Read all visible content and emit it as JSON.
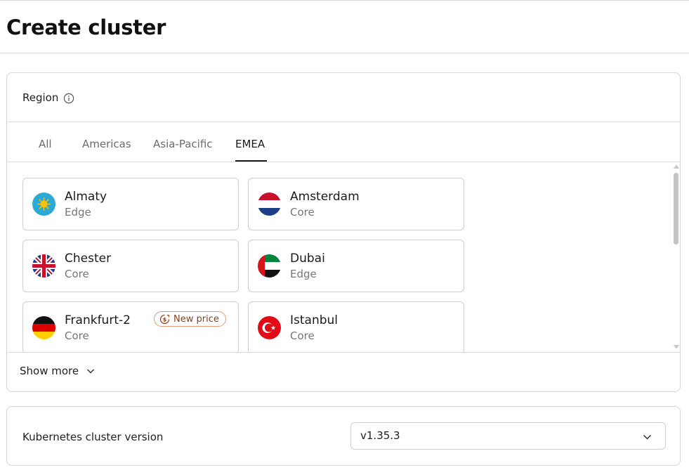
{
  "page": {
    "title": "Create cluster"
  },
  "region": {
    "label": "Region",
    "tabs": [
      {
        "label": "All",
        "active": false
      },
      {
        "label": "Americas",
        "active": false
      },
      {
        "label": "Asia-Pacific",
        "active": false
      },
      {
        "label": "EMEA",
        "active": true
      }
    ],
    "locations": [
      {
        "name": "Almaty",
        "type": "Edge",
        "flag": "kazakhstan-flag-icon"
      },
      {
        "name": "Amsterdam",
        "type": "Core",
        "flag": "netherlands-flag-icon"
      },
      {
        "name": "Chester",
        "type": "Core",
        "flag": "uk-flag-icon"
      },
      {
        "name": "Dubai",
        "type": "Edge",
        "flag": "uae-flag-icon"
      },
      {
        "name": "Frankfurt-2",
        "type": "Core",
        "flag": "germany-flag-icon",
        "badge": "New price"
      },
      {
        "name": "Istanbul",
        "type": "Core",
        "flag": "turkey-flag-icon"
      }
    ],
    "show_more_label": "Show more"
  },
  "kubernetes": {
    "label": "Kubernetes cluster version",
    "selected_version": "v1.35.3"
  },
  "colors": {
    "badge_border": "#e79a74",
    "badge_text": "#8a3f1d",
    "active_tab": "#1a1a1a"
  }
}
